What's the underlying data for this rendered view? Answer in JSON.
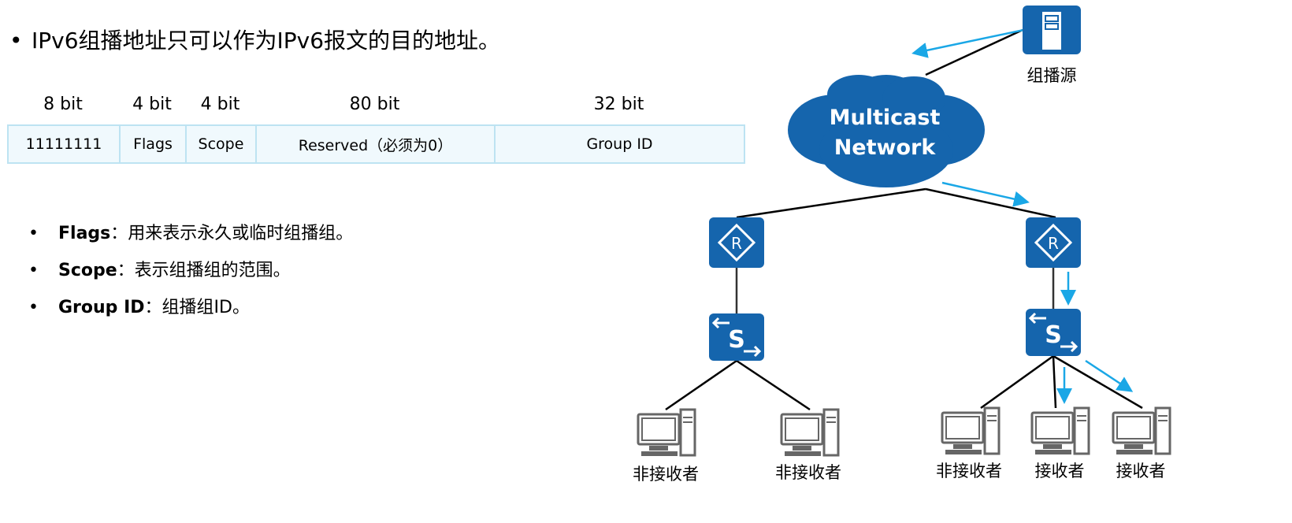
{
  "title": "IPv6组播地址只可以作为IPv6报文的目的地址。",
  "bit_widths": [
    "8 bit",
    "4 bit",
    "4 bit",
    "80 bit",
    "32 bit"
  ],
  "fields": [
    "11111111",
    "Flags",
    "Scope",
    "Reserved（必须为0）",
    "Group ID"
  ],
  "bullets": [
    {
      "term": "Flags",
      "desc": "：用来表示永久或临时组播组。"
    },
    {
      "term": "Scope",
      "desc": "：表示组播组的范围。"
    },
    {
      "term": "Group ID",
      "desc": "：组播组ID。"
    }
  ],
  "diagram": {
    "source_label": "组播源",
    "cloud_line1": "Multicast",
    "cloud_line2": "Network",
    "router_glyph": "R",
    "switch_glyph": "S",
    "hosts": [
      "非接收者",
      "非接收者",
      "非接收者",
      "接收者",
      "接收者"
    ],
    "colors": {
      "device": "#1565ad",
      "arrow": "#1aa7e6",
      "table_border": "#bde3f2",
      "table_fill": "#f0f9fd"
    }
  }
}
